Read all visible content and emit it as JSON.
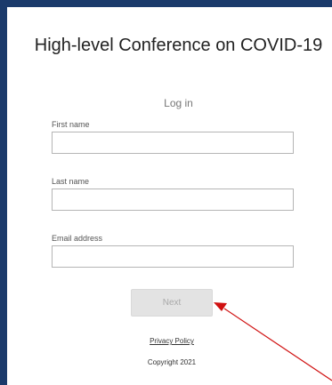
{
  "page": {
    "title": "High-level Conference on COVID-19",
    "subtitle": "Log in"
  },
  "form": {
    "first_name": {
      "label": "First name",
      "value": "",
      "placeholder": ""
    },
    "last_name": {
      "label": "Last name",
      "value": "",
      "placeholder": ""
    },
    "email": {
      "label": "Email address",
      "value": "",
      "placeholder": ""
    },
    "next_label": "Next"
  },
  "footer": {
    "privacy_label": "Privacy Policy",
    "copyright": "Copyright 2021"
  },
  "colors": {
    "frame_border": "#1b3a6b",
    "button_bg": "#e3e3e3",
    "button_text": "#a9a9a9",
    "annotation_arrow": "#d01010"
  },
  "icons": {
    "annotation": "red-arrow-icon"
  }
}
